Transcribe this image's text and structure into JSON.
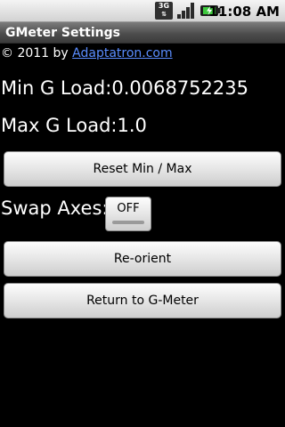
{
  "status_bar": {
    "network_label": "3G",
    "time": "11:08",
    "time_suffix": "AM",
    "icons": [
      "3g-data-icon",
      "signal-strength-icon",
      "battery-icon"
    ]
  },
  "title_bar": {
    "title": "GMeter Settings"
  },
  "copyright": {
    "prefix": "© 2011 by ",
    "link_text": "Adaptatron.com"
  },
  "loads": {
    "min_label": "Min G Load:",
    "min_value": "0.0068752235",
    "max_label": "Max G Load:",
    "max_value": "1.0"
  },
  "buttons": {
    "reset": "Reset Min / Max",
    "reorient": "Re-orient",
    "return": "Return to G-Meter"
  },
  "swap_axes": {
    "label": "Swap Axes:",
    "state": "OFF"
  },
  "colors": {
    "background": "#000000",
    "link": "#5a8dff",
    "battery_fill": "#3ec93e"
  }
}
